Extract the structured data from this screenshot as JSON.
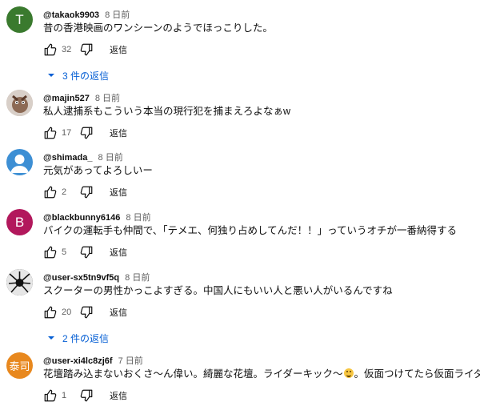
{
  "comments": [
    {
      "avatar_letter": "T",
      "avatar_color": "#3a7a2e",
      "author": "@takaok9903",
      "time": "8 日前",
      "text": "昔の香港映画のワンシーンのようでほっこりした。",
      "likes": "32",
      "reply_label": "返信",
      "replies_label": "3 件の返信"
    },
    {
      "avatar_letter": "",
      "avatar_color": "#9a7f6e",
      "author": "@majin527",
      "time": "8 日前",
      "text": "私人逮捕系もこういう本当の現行犯を捕まえろよなぁw",
      "likes": "17",
      "reply_label": "返信"
    },
    {
      "avatar_letter": "",
      "avatar_color": "#3d8fd4",
      "author": "@shimada_",
      "time": "8 日前",
      "text": "元気があってよろしいー",
      "likes": "2",
      "reply_label": "返信"
    },
    {
      "avatar_letter": "B",
      "avatar_color": "#b2185c",
      "author": "@blackbunny6146",
      "time": "8 日前",
      "text": "バイクの運転手も仲間で、「テメエ、何独り占めしてんだ！！」っていうオチが一番納得する",
      "likes": "5",
      "reply_label": "返信"
    },
    {
      "avatar_letter": "",
      "avatar_color": "#2a2a2a",
      "author": "@user-sx5tn9vf5q",
      "time": "8 日前",
      "text": "スクーターの男性かっこよすぎる。中国人にもいい人と悪い人がいるんですね",
      "likes": "20",
      "reply_label": "返信",
      "replies_label": "2 件の返信"
    },
    {
      "avatar_letter": "泰司",
      "avatar_color": "#e8881e",
      "author": "@user-xi4lc8zj6f",
      "time": "7 日前",
      "text_part1": "花壇踏み込まないおくさ〜ん偉い。綺麗な花壇。ライダーキック〜",
      "text_part2": "。仮面つけてたら仮面ライダー",
      "emoji": "smiling-face-with-sweat-icon",
      "likes": "1",
      "reply_label": "返信"
    }
  ]
}
